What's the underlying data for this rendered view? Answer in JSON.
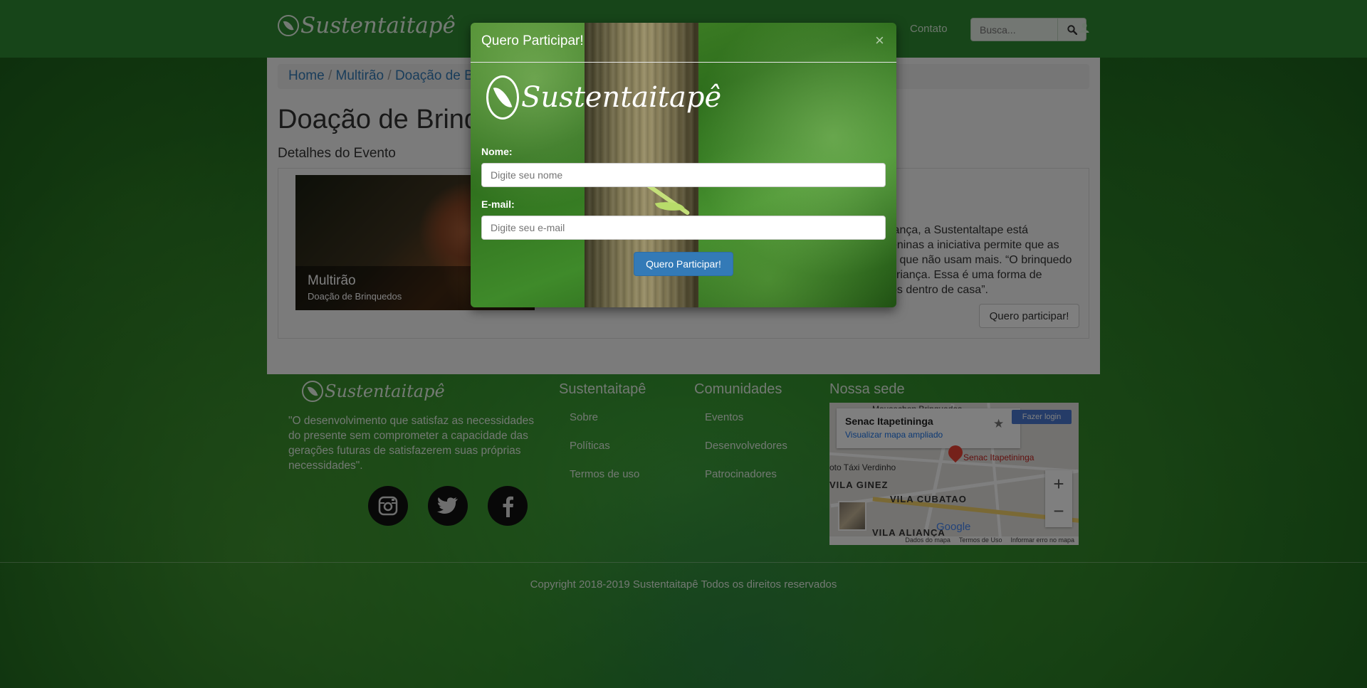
{
  "nav": {
    "brand": "Sustentaitapê",
    "link_contato": "Contato",
    "search_placeholder": "Busca..."
  },
  "breadcrumb": {
    "items": [
      "Home",
      "Multirão",
      "Doação de Brinquedos"
    ]
  },
  "page": {
    "title": "Doação de Brinquedos",
    "subtitle": "Detalhes do Evento",
    "image_caption_title": "Multirão",
    "image_caption_sub": "Doação de Brinquedos",
    "event_text": "iança, a Sustentaltape está\neninas a iniciativa permite que as\ns que não usam mais. “O brinquedo\ncriança. Essa é uma forma de\nos dentro de casa”.",
    "participate_button": "Quero participar!"
  },
  "footer": {
    "brand": "Sustentaitapê",
    "quote": "\"O desenvolvimento que satisfaz as necessidades do presente sem comprometer a capacidade das gerações futuras de satisfazerem suas próprias necessidades\".",
    "col1_title": "Sustentaitapê",
    "col1_links": [
      "Sobre",
      "Políticas",
      "Termos de uso"
    ],
    "col2_title": "Comunidades",
    "col2_links": [
      "Eventos",
      "Desenvolvedores",
      "Patrocinadores"
    ],
    "col3_title": "Nossa sede",
    "copyright": "Copyright 2018-2019 Sustentaitapê Todos os direitos reservados"
  },
  "map": {
    "place_name": "Senac Itapetininga",
    "view_larger": "Visualizar mapa ampliado",
    "login": "Fazer login",
    "pin_label": "Senac Itapetininga",
    "area1": "VILA GINEZ",
    "area2": "VILA CUBATAO",
    "area3": "VILA ALIANÇA",
    "place_taxi": "oto Táxi Verdinho",
    "place_top": "Mousechon Brinquedos",
    "google": "Google",
    "footer_items": [
      "Dados do mapa",
      "Termos de Uso",
      "Informar erro no mapa"
    ]
  },
  "modal": {
    "title": "Quero Participar!",
    "close": "×",
    "brand": "Sustentaitapê",
    "name_label": "Nome:",
    "name_placeholder": "Digite seu nome",
    "email_label": "E-mail:",
    "email_placeholder": "Digite seu e-mail",
    "submit": "Quero Participar!"
  },
  "colors": {
    "navbar": "#2e8b32",
    "primary_button": "#337ab7",
    "link": "#337ab7"
  },
  "icons": [
    "leaf-logo-icon",
    "search-icon",
    "user-icon",
    "instagram-icon",
    "twitter-icon",
    "facebook-icon",
    "close-icon",
    "star-icon",
    "map-pin-icon"
  ]
}
